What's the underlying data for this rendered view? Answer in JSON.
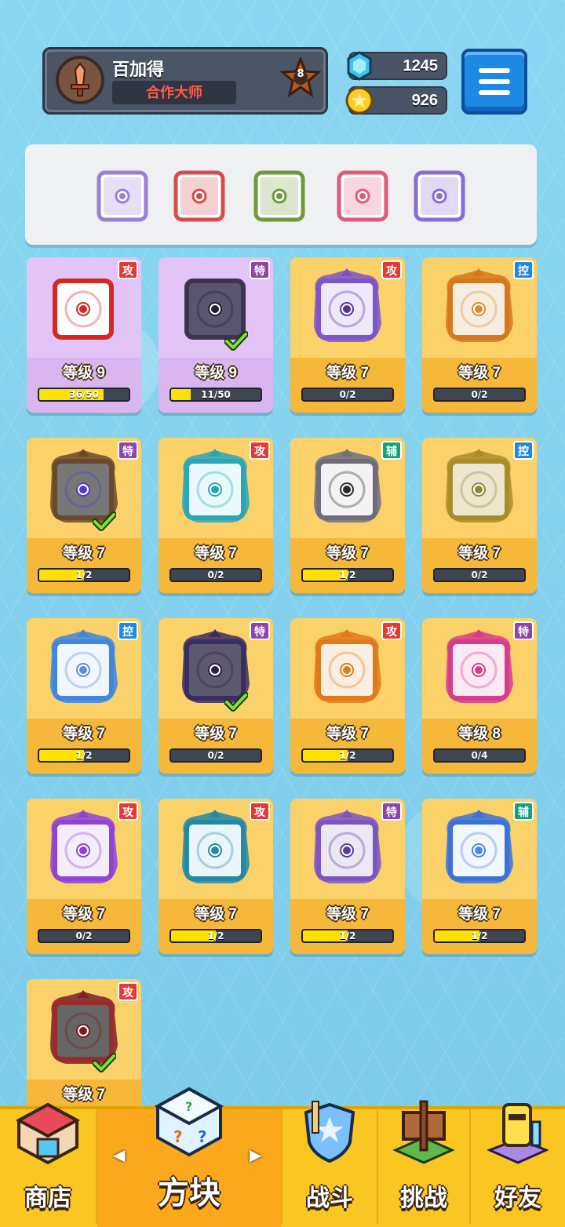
{
  "profile": {
    "name": "百加得",
    "title": "合作大师",
    "rank": "8"
  },
  "resources": {
    "gems": "1245",
    "coins": "926"
  },
  "deck": [
    {
      "color": "#9b7fd6",
      "kind": "cracked"
    },
    {
      "color": "#d44c4c",
      "kind": "vortex"
    },
    {
      "color": "#6c9a3a",
      "kind": "infinity"
    },
    {
      "color": "#e05a7a",
      "kind": "rainbow"
    },
    {
      "color": "#8a6ad9",
      "kind": "spikes"
    }
  ],
  "cards": [
    {
      "tag": "攻",
      "tagType": "gong",
      "level": "等级 9",
      "progress": "36/50",
      "fill": 0.72,
      "owned": true,
      "border": "#d7281f",
      "inner": "#ffffff",
      "dot": "#d7281f",
      "check": false,
      "dragon": ""
    },
    {
      "tag": "特",
      "tagType": "te",
      "level": "等级 9",
      "progress": "11/50",
      "fill": 0.22,
      "owned": true,
      "border": "#3d3452",
      "inner": "#5b5670",
      "dot": "#221c30",
      "check": true,
      "dragon": ""
    },
    {
      "tag": "攻",
      "tagType": "gong",
      "level": "等级 7",
      "progress": "0/2",
      "fill": 0,
      "owned": false,
      "border": "#7c55c8",
      "inner": "#efe8f8",
      "dot": "#5a2ea6",
      "check": false,
      "dragon": "#7d52c9"
    },
    {
      "tag": "控",
      "tagType": "kong",
      "level": "等级 7",
      "progress": "0/2",
      "fill": 0,
      "owned": false,
      "border": "#d7771d",
      "inner": "#f5ede2",
      "dot": "#e08a2c",
      "check": false,
      "dragon": "#d7771d"
    },
    {
      "tag": "特",
      "tagType": "te",
      "level": "等级 7",
      "progress": "1/2",
      "fill": 0.5,
      "owned": false,
      "border": "#6a4a2c",
      "inner": "#777777",
      "dot": "#4f3bd0",
      "check": true,
      "dragon": "#6a4a2c"
    },
    {
      "tag": "攻",
      "tagType": "gong",
      "level": "等级 7",
      "progress": "0/2",
      "fill": 0,
      "owned": false,
      "border": "#2aa6b8",
      "inner": "#eafafc",
      "dot": "#2aa6b8",
      "check": false,
      "dragon": "#2aa6b8"
    },
    {
      "tag": "辅",
      "tagType": "fu",
      "level": "等级 7",
      "progress": "1/2",
      "fill": 0.5,
      "owned": false,
      "border": "#6c6c7c",
      "inner": "#f3f3f3",
      "dot": "#2a2a2a",
      "check": false,
      "dragon": "#70707e"
    },
    {
      "tag": "控",
      "tagType": "kong",
      "level": "等级 7",
      "progress": "0/2",
      "fill": 0,
      "owned": false,
      "border": "#a88c2a",
      "inner": "#ece6cf",
      "dot": "#8f8a35",
      "check": false,
      "dragon": "#a88c2a"
    },
    {
      "tag": "控",
      "tagType": "kong",
      "level": "等级 7",
      "progress": "1/2",
      "fill": 0.5,
      "owned": false,
      "border": "#3f86e0",
      "inner": "#f2f7fd",
      "dot": "#5a8fe0",
      "check": false,
      "dragon": "#3f86e0"
    },
    {
      "tag": "特",
      "tagType": "te",
      "level": "等级 7",
      "progress": "0/2",
      "fill": 0,
      "owned": false,
      "border": "#3b2d63",
      "inner": "#5e5a6e",
      "dot": "#2c1e48",
      "check": true,
      "dragon": "#3b2d63"
    },
    {
      "tag": "攻",
      "tagType": "gong",
      "level": "等级 7",
      "progress": "1/2",
      "fill": 0.5,
      "owned": false,
      "border": "#e07a1a",
      "inner": "#fbefe2",
      "dot": "#e07a1a",
      "check": false,
      "dragon": "#e07a1a"
    },
    {
      "tag": "特",
      "tagType": "te",
      "level": "等级 8",
      "progress": "0/4",
      "fill": 0,
      "owned": false,
      "border": "#d63c8a",
      "inner": "#fbeaf3",
      "dot": "#d63c8a",
      "check": false,
      "dragon": "#d63c8a"
    },
    {
      "tag": "攻",
      "tagType": "gong",
      "level": "等级 7",
      "progress": "0/2",
      "fill": 0,
      "owned": false,
      "border": "#8e44d6",
      "inner": "#f4eefc",
      "dot": "#8e44d6",
      "check": false,
      "dragon": "#8e44d6"
    },
    {
      "tag": "攻",
      "tagType": "gong",
      "level": "等级 7",
      "progress": "1/2",
      "fill": 0.5,
      "owned": false,
      "border": "#2589a6",
      "inner": "#eaf6fa",
      "dot": "#2589a6",
      "check": false,
      "dragon": "#2589a6"
    },
    {
      "tag": "特",
      "tagType": "te",
      "level": "等级 7",
      "progress": "1/2",
      "fill": 0.5,
      "owned": false,
      "border": "#7b56c0",
      "inner": "#ece8f3",
      "dot": "#5b3aa3",
      "check": false,
      "dragon": "#7b56c0"
    },
    {
      "tag": "辅",
      "tagType": "fu",
      "level": "等级 7",
      "progress": "1/2",
      "fill": 0.5,
      "owned": false,
      "border": "#3a72d6",
      "inner": "#f2f6fd",
      "dot": "#4a86e6",
      "check": false,
      "dragon": "#3a72d6"
    },
    {
      "tag": "攻",
      "tagType": "gong",
      "level": "等级 7",
      "progress": "",
      "fill": 0,
      "owned": false,
      "border": "#9b2c2c",
      "inner": "#666666",
      "dot": "#7a1a1a",
      "check": true,
      "dragon": "#7a1f30"
    }
  ],
  "nav": {
    "shop": "商店",
    "blocks": "方块",
    "battle": "战斗",
    "challenge": "挑战",
    "friends": "好友"
  },
  "colors": {
    "accent": "#f9c622",
    "menu": "#1e88e5",
    "card_bg": "#f6b83a"
  }
}
